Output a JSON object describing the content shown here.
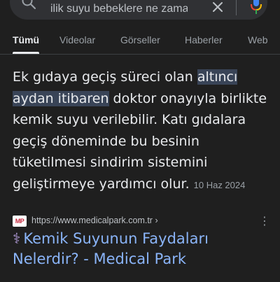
{
  "search": {
    "query": "ilik suyu bebeklere ne zaman"
  },
  "tabs": [
    {
      "label": "Tümü",
      "active": true
    },
    {
      "label": "Videolar",
      "active": false
    },
    {
      "label": "Görseller",
      "active": false
    },
    {
      "label": "Haberler",
      "active": false
    },
    {
      "label": "Web",
      "active": false
    }
  ],
  "snippet": {
    "text_before": "Ek gıdaya geçiş süreci olan ",
    "highlight": "altıncı aydan itibaren",
    "text_after": " doktor onayıyla birlikte kemik suyu verilebilir. Katı gıdalara geçiş döneminde bu besinin tüketilmesi sindirim sistemini geliştirmeye yardımcı olur.",
    "date": "10 Haz 2024"
  },
  "result": {
    "favicon_text": "MP",
    "url": "https://www.medicalpark.com.tr",
    "url_more": "›",
    "title_icon": "⚕",
    "title": "Kemik Suyunun Faydaları Nelerdir? - Medical Park"
  },
  "colors": {
    "background": "#1f1f1f",
    "link": "#8ab4f8",
    "highlight_bg": "#394457",
    "mic_blue": "#4285f4",
    "mic_red": "#ea4335",
    "mic_yellow": "#fbbc05",
    "mic_green": "#34a853"
  },
  "icons": [
    "search-icon",
    "clear-icon",
    "microphone-icon",
    "more-vert-icon",
    "caduceus-icon"
  ]
}
